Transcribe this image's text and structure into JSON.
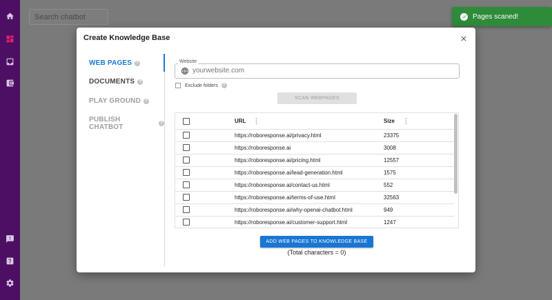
{
  "sidebar": {
    "icons": [
      "home-icon",
      "dashboard-icon",
      "inbox-icon",
      "wallet-icon",
      "feedback-icon",
      "help-icon",
      "settings-icon"
    ]
  },
  "background": {
    "search_placeholder": "Search chatbot"
  },
  "toast": {
    "message": "Pages scaned!",
    "color": "#2e8b3a"
  },
  "modal": {
    "title": "Create Knowledge Base",
    "steps": [
      {
        "label": "WEB PAGES",
        "active": true
      },
      {
        "label": "DOCUMENTS",
        "active": false
      },
      {
        "label": "PLAY GROUND",
        "active": false
      },
      {
        "label": "PUBLISH CHATBOT",
        "active": false
      }
    ],
    "website_label": "Website",
    "website_placeholder": "yourwebsite.com",
    "exclude_label": "Exclude folders",
    "scan_button": "SCAN WEBPAGES",
    "table": {
      "headers": {
        "url": "URL",
        "size": "Size"
      },
      "rows": [
        {
          "url": "https://roboresponse.ai/privacy.html",
          "size": "23375"
        },
        {
          "url": "https://roboresponse.ai",
          "size": "3008"
        },
        {
          "url": "https://roboresponse.ai/pricing.html",
          "size": "12557"
        },
        {
          "url": "https://roboresponse.ai/lead-generation.html",
          "size": "1575"
        },
        {
          "url": "https://roboresponse.ai/contact-us.html",
          "size": "552"
        },
        {
          "url": "https://roboresponse.ai/terms-of-use.html",
          "size": "32563"
        },
        {
          "url": "https://roboresponse.ai/why-openai-chatbot.html",
          "size": "949"
        },
        {
          "url": "https://roboresponse.ai/customer-support.html",
          "size": "1247"
        }
      ]
    },
    "add_button": "ADD WEB PAGES TO KNOWLEDGE BASE",
    "total_text": "(Total characters = 0)"
  },
  "colors": {
    "sidebar": "#4d0f63",
    "accent": "#1976d2",
    "success": "#2e8b3a"
  }
}
